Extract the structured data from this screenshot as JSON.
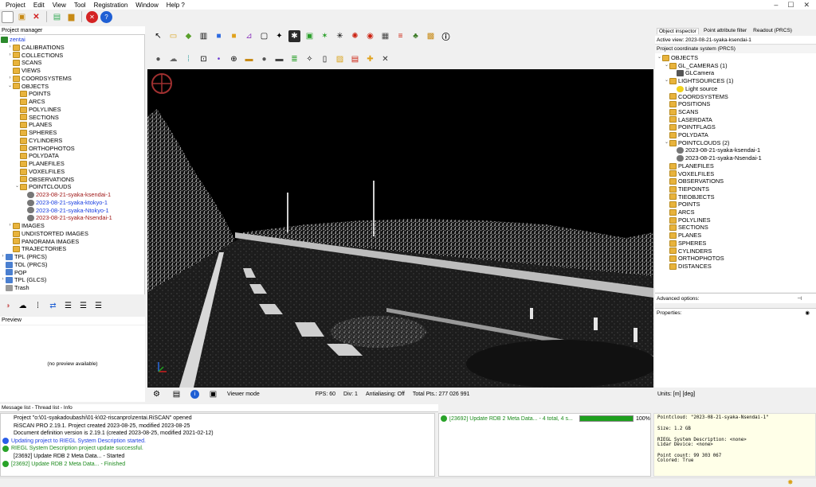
{
  "menu": [
    "Project",
    "Edit",
    "View",
    "Tool",
    "Registration",
    "Window",
    "Help ?"
  ],
  "window_controls": [
    "–",
    "☐",
    "✕"
  ],
  "project_manager": {
    "title": "Project manager",
    "root": "zentai",
    "items": [
      {
        "label": "CALIBRATIONS",
        "depth": 1,
        "exp": "›"
      },
      {
        "label": "COLLECTIONS",
        "depth": 1,
        "exp": "›"
      },
      {
        "label": "SCANS",
        "depth": 1,
        "exp": ""
      },
      {
        "label": "VIEWS",
        "depth": 1,
        "exp": ""
      },
      {
        "label": "COORDSYSTEMS",
        "depth": 1,
        "exp": "›"
      },
      {
        "label": "OBJECTS",
        "depth": 1,
        "exp": "⌄"
      },
      {
        "label": "POINTS",
        "depth": 2,
        "exp": ""
      },
      {
        "label": "ARCS",
        "depth": 2,
        "exp": ""
      },
      {
        "label": "POLYLINES",
        "depth": 2,
        "exp": ""
      },
      {
        "label": "SECTIONS",
        "depth": 2,
        "exp": ""
      },
      {
        "label": "PLANES",
        "depth": 2,
        "exp": ""
      },
      {
        "label": "SPHERES",
        "depth": 2,
        "exp": ""
      },
      {
        "label": "CYLINDERS",
        "depth": 2,
        "exp": ""
      },
      {
        "label": "ORTHOPHOTOS",
        "depth": 2,
        "exp": ""
      },
      {
        "label": "POLYDATA",
        "depth": 2,
        "exp": ""
      },
      {
        "label": "PLANEFILES",
        "depth": 2,
        "exp": ""
      },
      {
        "label": "VOXELFILES",
        "depth": 2,
        "exp": ""
      },
      {
        "label": "OBSERVATIONS",
        "depth": 2,
        "exp": ""
      },
      {
        "label": "POINTCLOUDS",
        "depth": 2,
        "exp": "⌄"
      },
      {
        "label": "2023-08-21-syaka-ksendai-1",
        "depth": 3,
        "exp": "",
        "cls": "red"
      },
      {
        "label": "2023-08-21-syaka-ktokyo-1",
        "depth": 3,
        "exp": "",
        "cls": "blue"
      },
      {
        "label": "2023-08-21-syaka-Ntokyo-1",
        "depth": 3,
        "exp": "",
        "cls": "blue"
      },
      {
        "label": "2023-08-21-syaka-Nsendai-1",
        "depth": 3,
        "exp": "",
        "cls": "red"
      },
      {
        "label": "IMAGES",
        "depth": 1,
        "exp": "›"
      },
      {
        "label": "UNDISTORTED IMAGES",
        "depth": 1,
        "exp": ""
      },
      {
        "label": "PANORAMA IMAGES",
        "depth": 1,
        "exp": ""
      },
      {
        "label": "TRAJECTORIES",
        "depth": 1,
        "exp": ""
      },
      {
        "label": "TPL (PRCS)",
        "depth": 0,
        "exp": "›"
      },
      {
        "label": "TOL (PRCS)",
        "depth": 0,
        "exp": ""
      },
      {
        "label": "POP",
        "depth": 0,
        "exp": ""
      },
      {
        "label": "TPL (GLCS)",
        "depth": 0,
        "exp": "›"
      },
      {
        "label": "Trash",
        "depth": 0,
        "exp": ""
      }
    ]
  },
  "preview": {
    "title": "Preview",
    "text": "(no preview available)"
  },
  "viewport_status": {
    "mode": "Viewer mode",
    "fps": "FPS: 60",
    "div": "Div: 1",
    "antialiasing": "Antialiasing: Off",
    "total": "Total Pts.: 277 026 991"
  },
  "object_inspector": {
    "tabs": [
      "Object inspector",
      "Point attribute filter",
      "Readout (PRCS)"
    ],
    "active_view": "Active view: 2023-08-21-syaka-ksendai-1",
    "prcs": "Project coordinate system (PRCS)",
    "items": [
      {
        "label": "OBJECTS",
        "depth": 0,
        "exp": "⌄"
      },
      {
        "label": "GL_CAMERAS (1)",
        "depth": 1,
        "exp": "⌄"
      },
      {
        "label": "GLCamera",
        "depth": 2,
        "exp": ""
      },
      {
        "label": "LIGHTSOURCES (1)",
        "depth": 1,
        "exp": "⌄"
      },
      {
        "label": "Light source",
        "depth": 2,
        "exp": ""
      },
      {
        "label": "COORDSYSTEMS",
        "depth": 1,
        "exp": ""
      },
      {
        "label": "POSITIONS",
        "depth": 1,
        "exp": ""
      },
      {
        "label": "SCANS",
        "depth": 1,
        "exp": ""
      },
      {
        "label": "LASERDATA",
        "depth": 1,
        "exp": ""
      },
      {
        "label": "POINTFLAGS",
        "depth": 1,
        "exp": ""
      },
      {
        "label": "POLYDATA",
        "depth": 1,
        "exp": ""
      },
      {
        "label": "POINTCLOUDS (2)",
        "depth": 1,
        "exp": "⌄"
      },
      {
        "label": "2023-08-21-syaka-ksendai-1",
        "depth": 2,
        "exp": ""
      },
      {
        "label": "2023-08-21-syaka-Nsendai-1",
        "depth": 2,
        "exp": ""
      },
      {
        "label": "PLANEFILES",
        "depth": 1,
        "exp": ""
      },
      {
        "label": "VOXELFILES",
        "depth": 1,
        "exp": ""
      },
      {
        "label": "OBSERVATIONS",
        "depth": 1,
        "exp": ""
      },
      {
        "label": "TIEPOINTS",
        "depth": 1,
        "exp": ""
      },
      {
        "label": "TIEOBJECTS",
        "depth": 1,
        "exp": ""
      },
      {
        "label": "POINTS",
        "depth": 1,
        "exp": ""
      },
      {
        "label": "ARCS",
        "depth": 1,
        "exp": ""
      },
      {
        "label": "POLYLINES",
        "depth": 1,
        "exp": ""
      },
      {
        "label": "SECTIONS",
        "depth": 1,
        "exp": ""
      },
      {
        "label": "PLANES",
        "depth": 1,
        "exp": ""
      },
      {
        "label": "SPHERES",
        "depth": 1,
        "exp": ""
      },
      {
        "label": "CYLINDERS",
        "depth": 1,
        "exp": ""
      },
      {
        "label": "ORTHOPHOTOS",
        "depth": 1,
        "exp": ""
      },
      {
        "label": "DISTANCES",
        "depth": 1,
        "exp": ""
      }
    ],
    "advanced_options": "Advanced options:",
    "properties": "Properties:",
    "units": "Units: [m] [deg]"
  },
  "messages": {
    "tabs": "Message list - Thread list - Info",
    "lines": [
      {
        "text": "Project \"o:\\01-syakadoubashi\\01-k\\02-riscanpro\\zentai.RiSCAN\" opened",
        "icon": "",
        "color": "#000"
      },
      {
        "text": "RiSCAN PRO 2.19.1. Project created 2023-08-25, modified 2023-08-25",
        "icon": "",
        "color": "#000"
      },
      {
        "text": "Document definition version is 2.19.1 (created 2023-08-25, modified 2021-02-12)",
        "icon": "",
        "color": "#000"
      },
      {
        "text": "Updating project to RIEGL System Description started.",
        "icon": "#2a5ee8",
        "color": "#1a3ee0"
      },
      {
        "text": "RIEGL System Description project update successful.",
        "icon": "#29a329",
        "color": "#1b8a1b"
      },
      {
        "text": "[23692] Update RDB 2 Meta Data... - Started",
        "icon": "",
        "color": "#000"
      },
      {
        "text": "[23692] Update RDB 2 Meta Data... - Finished",
        "icon": "#29a329",
        "color": "#1b8a1b"
      }
    ],
    "progress_text": "[23692] Update RDB 2 Meta Data... - 4 total, 4 s...",
    "progress_pct": "100%",
    "progress_value": 1.0
  },
  "pointcloud_info": {
    "name": "Pointcloud: \"2023-08-21-syaka-Nsendai-1\"",
    "size": "Size: 1.2 GB",
    "riegl_desc": "RIEGL System Description: <none>",
    "lidar": "Lidar Device: <none>",
    "count": "Point count:  99 303 067",
    "colored": "Colored: True"
  }
}
